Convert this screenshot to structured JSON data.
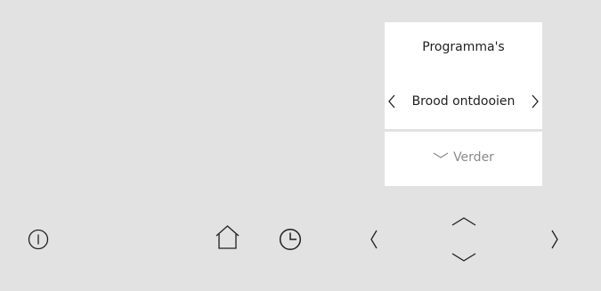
{
  "display": {
    "title": "Programma's",
    "program": "Brood ontdooien",
    "more_label": "Verder"
  },
  "icons": {
    "power": "power-icon",
    "home": "home-icon",
    "clock": "clock-icon",
    "left": "chevron-left-icon",
    "right": "chevron-right-icon",
    "up": "chevron-up-icon",
    "down": "chevron-down-icon"
  },
  "colors": {
    "background": "#e2e2e2",
    "panel": "#ffffff",
    "text": "#1f1f1f",
    "muted": "#8a8a8a"
  }
}
